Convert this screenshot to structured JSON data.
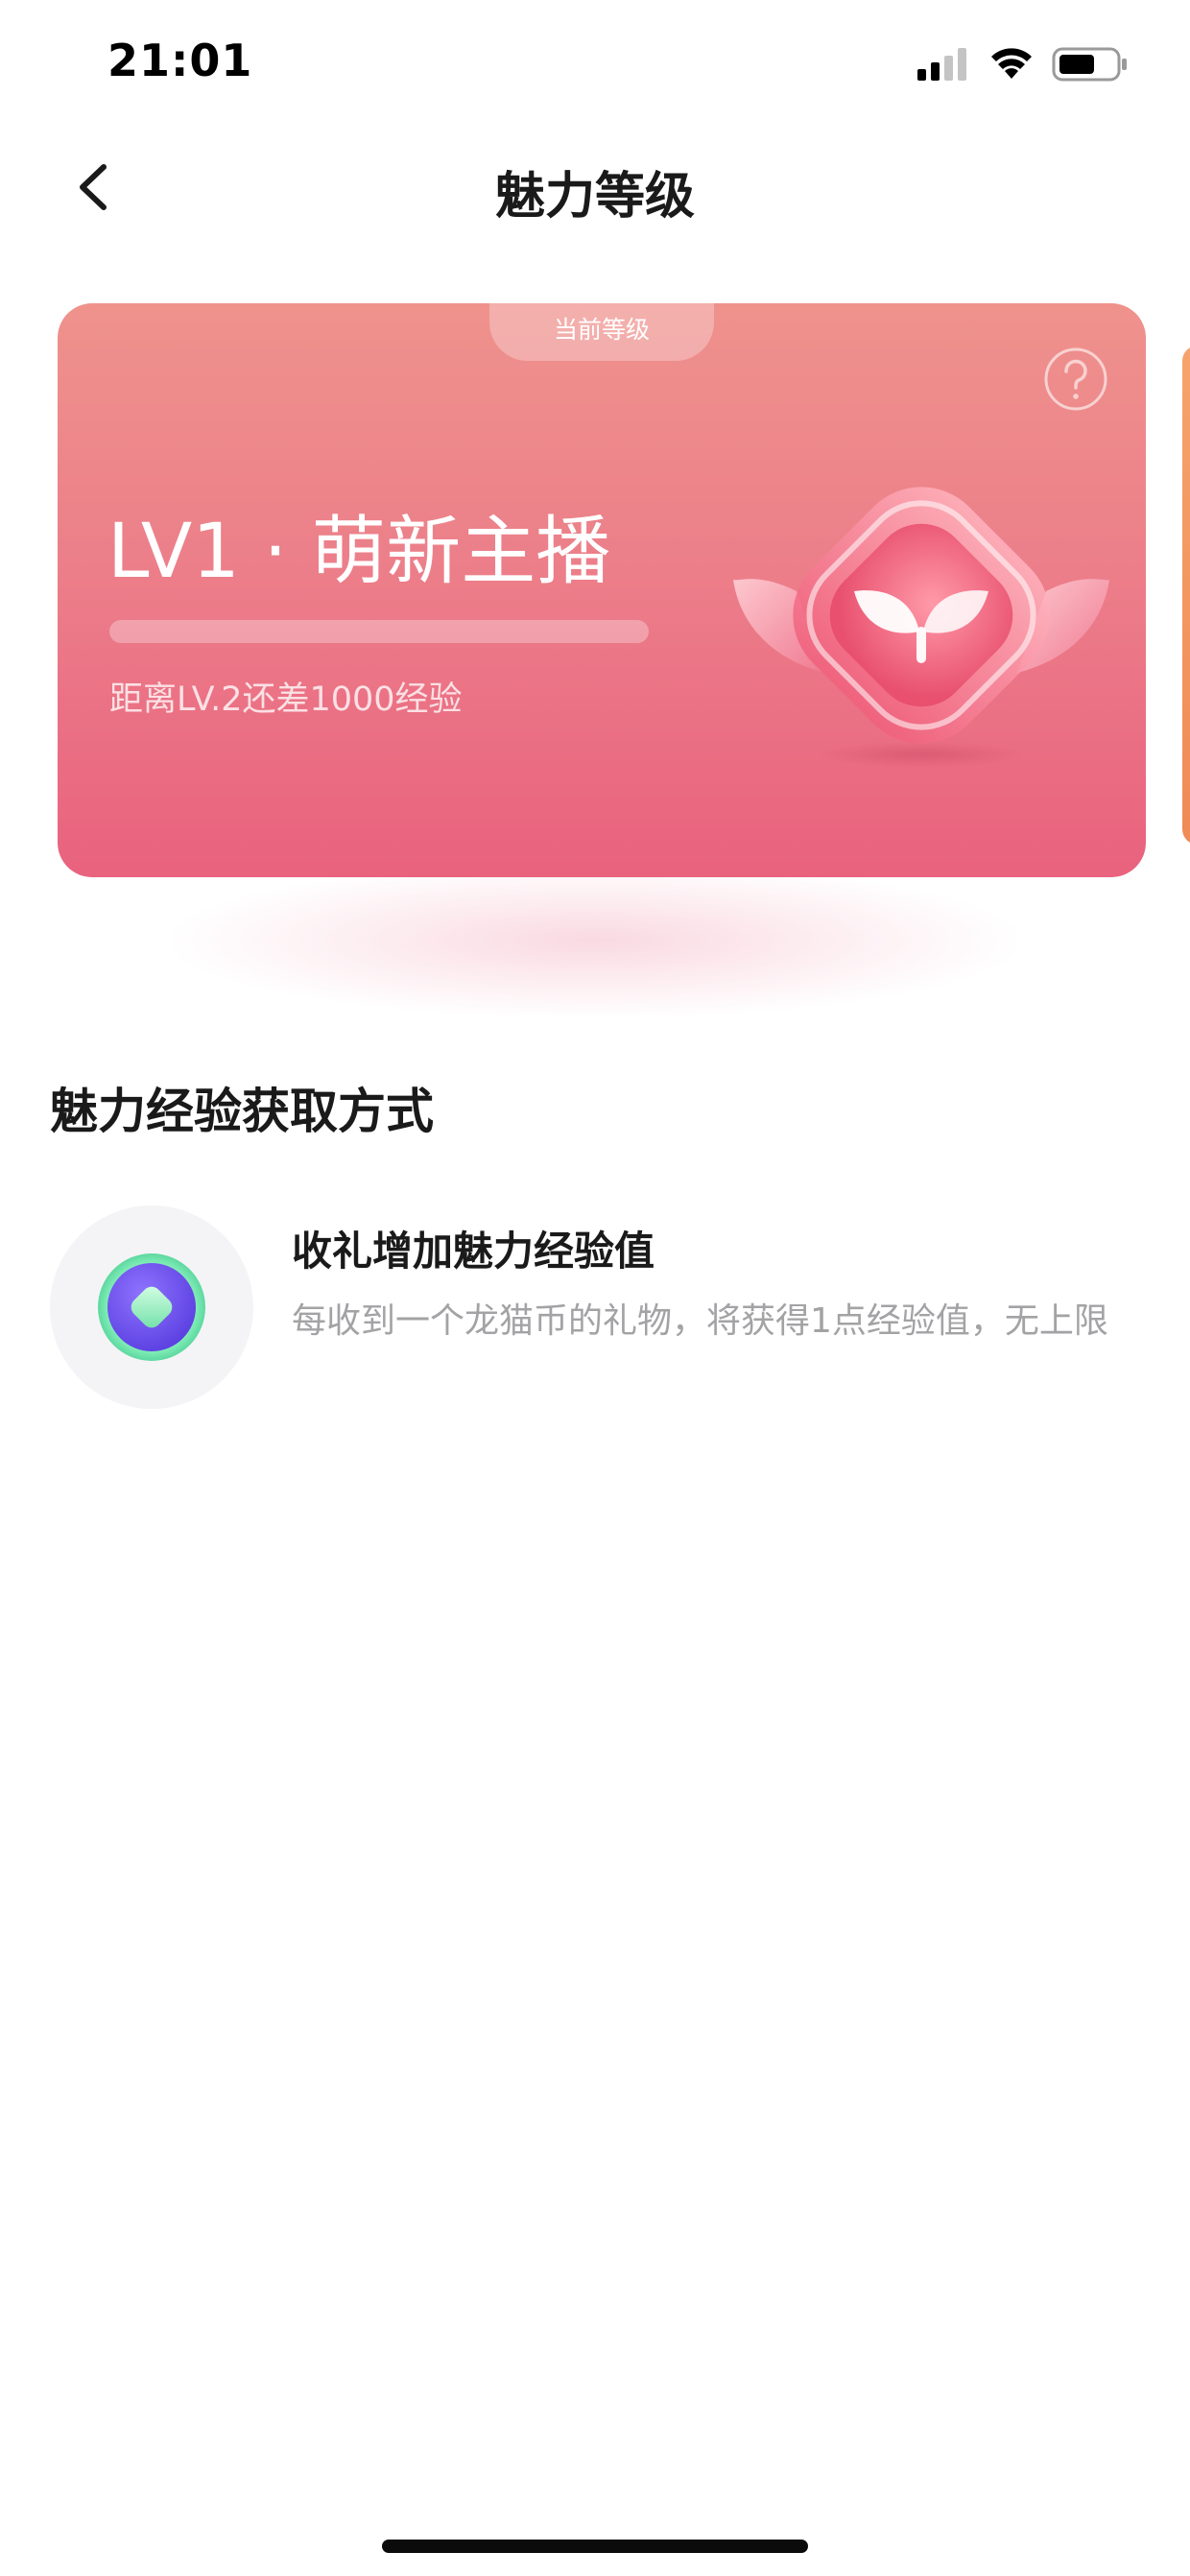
{
  "status_bar": {
    "time": "21:01"
  },
  "nav": {
    "title": "魅力等级"
  },
  "level_card": {
    "current_tab_label": "当前等级",
    "level_title": "LV1 · 萌新主播",
    "progress_fraction": 0.0,
    "exp_hint": "距离LV.2还差1000经验"
  },
  "section": {
    "title": "魅力经验获取方式",
    "items": [
      {
        "title": "收礼增加魅力经验值",
        "description": "每收到一个龙猫币的礼物，将获得1点经验值，无上限"
      }
    ]
  },
  "colors": {
    "card_top": "#ef928c",
    "card_bottom": "#e9627e",
    "accent_orange": "#f08a56",
    "icon_purple": "#6a4ef0",
    "icon_green": "#7ff0b0"
  }
}
